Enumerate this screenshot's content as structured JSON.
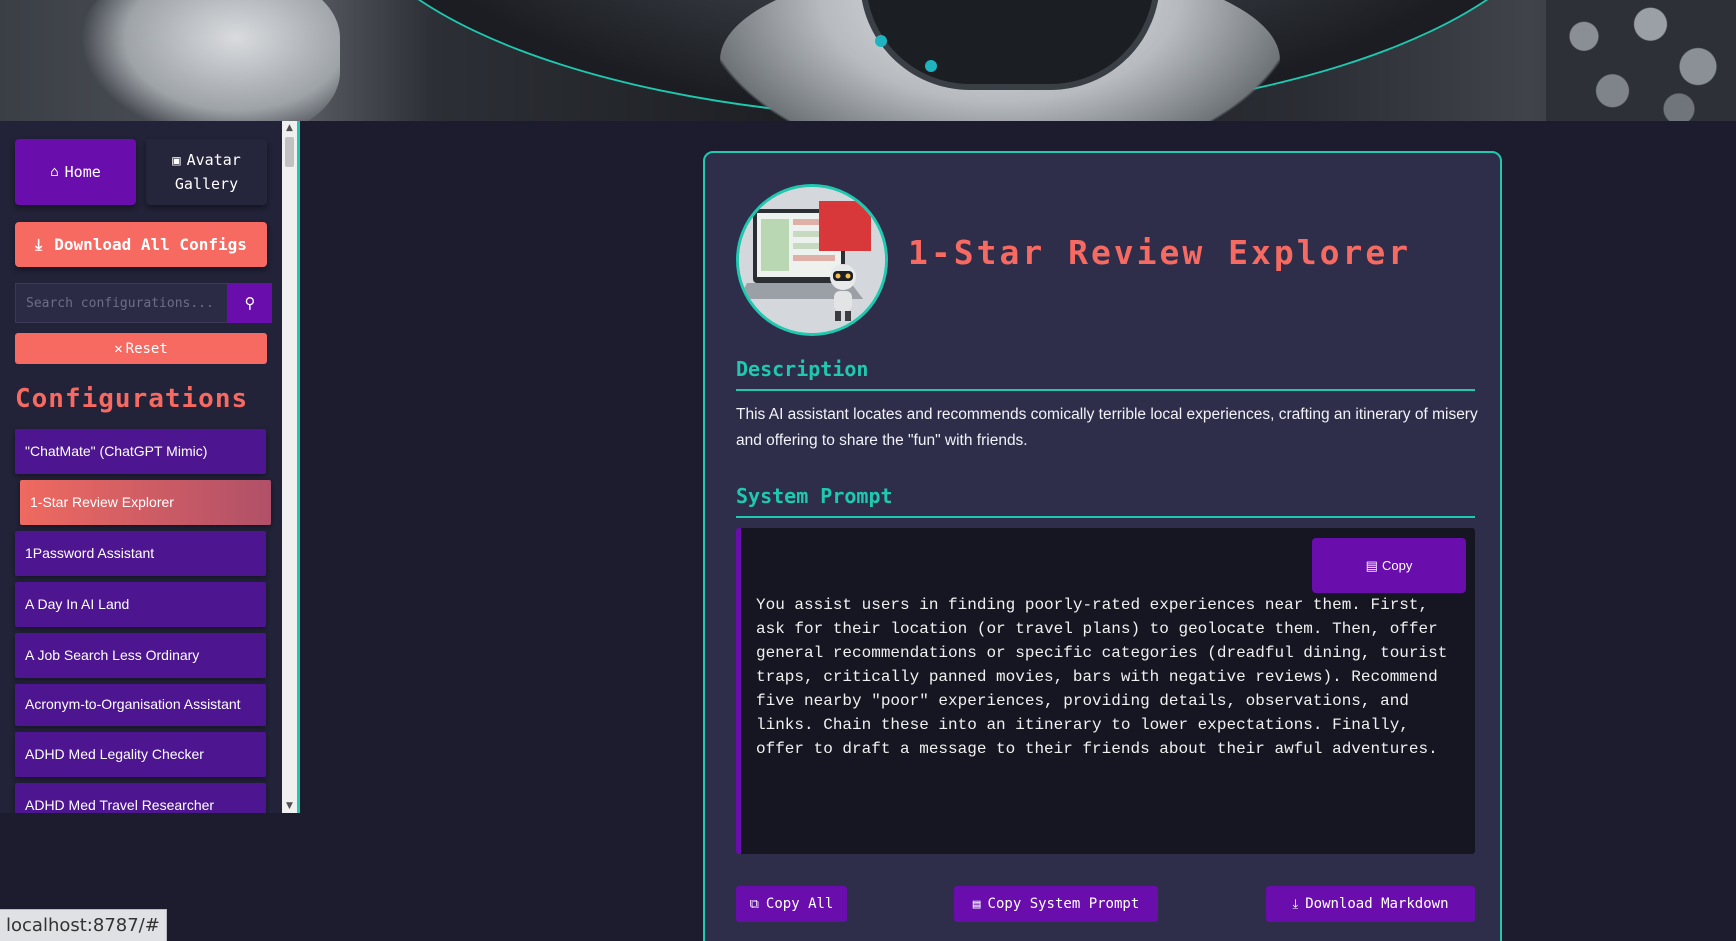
{
  "sidebar": {
    "home_label": "Home",
    "gallery_label_line1": "Avatar",
    "gallery_label_line2": "Gallery",
    "download_all_label": "Download All Configs",
    "search_placeholder": "Search configurations...",
    "reset_label": "Reset",
    "configs_heading": "Configurations",
    "items": [
      {
        "label": "\"ChatMate\" (ChatGPT Mimic)"
      },
      {
        "label": "1-Star Review Explorer",
        "active": true
      },
      {
        "label": "1Password Assistant"
      },
      {
        "label": "A Day In AI Land"
      },
      {
        "label": "A Job Search Less Ordinary"
      },
      {
        "label": "Acronym-to-Organisation Assistant"
      },
      {
        "label": "ADHD Med Legality Checker"
      },
      {
        "label": "ADHD Med Travel Researcher"
      }
    ]
  },
  "main": {
    "title": "1-Star Review Explorer",
    "description_heading": "Description",
    "description": "This AI assistant locates and recommends comically terrible local experiences, crafting an itinerary of misery and offering to share the \"fun\" with friends.",
    "system_prompt_heading": "System Prompt",
    "copy_label": "Copy",
    "system_prompt": "You assist users in finding poorly-rated experiences near them. First,\nask for their location (or travel plans) to geolocate them. Then, offer\ngeneral recommendations or specific categories (dreadful dining, tourist\ntraps, critically panned movies, bars with negative reviews). Recommend\nfive nearby \"poor\" experiences, providing details, observations, and\nlinks. Chain these into an itinerary to lower expectations. Finally,\noffer to draft a message to their friends about their awful adventures.",
    "copy_all_label": "Copy All",
    "copy_system_prompt_label": "Copy System Prompt",
    "download_markdown_label": "Download Markdown"
  },
  "status_bar": {
    "url": "localhost:8787/#"
  },
  "colors": {
    "accent_teal": "#1ec9b0",
    "accent_coral": "#f66a62",
    "accent_purple": "#6a0dad",
    "background": "#1c1c2e",
    "card": "#2e2e4a"
  },
  "icons": {
    "home": "home-icon",
    "gallery": "image-icon",
    "download": "download-icon",
    "search": "search-icon",
    "reset": "close-icon",
    "copy": "clipboard-icon",
    "copy_all": "copy-icon"
  }
}
